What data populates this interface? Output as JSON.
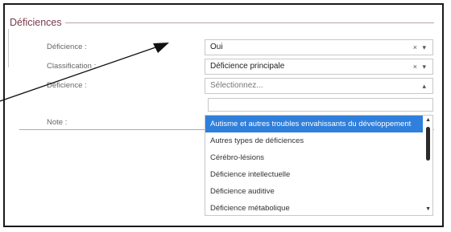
{
  "section": {
    "title": "Déficiences"
  },
  "fields": {
    "deficience_1": {
      "label": "Déficience :",
      "value": "Oui",
      "controls": "× ▾"
    },
    "classification": {
      "label": "Classification :",
      "value": "Déficience principale",
      "controls": "× ▾"
    },
    "deficience_2": {
      "label": "Déficience :",
      "placeholder": "Sélectionnez...",
      "controls": "▴"
    },
    "note": {
      "label": "Note :"
    }
  },
  "dropdown": {
    "options": [
      "Autisme et autres troubles envahissants du développement",
      "Autres types de déficiences",
      "Cérébro-lésions",
      "Déficience intellectuelle",
      "Déficience auditive",
      "Déficience métabolique"
    ],
    "highlighted_index": 0
  },
  "colors": {
    "highlight": "#2f7fdc",
    "section_title": "#7a3a4a",
    "arrow": "#111111"
  },
  "icons": {
    "clear": "close-icon",
    "open": "chevron-down-icon",
    "collapse": "chevron-up-icon"
  }
}
